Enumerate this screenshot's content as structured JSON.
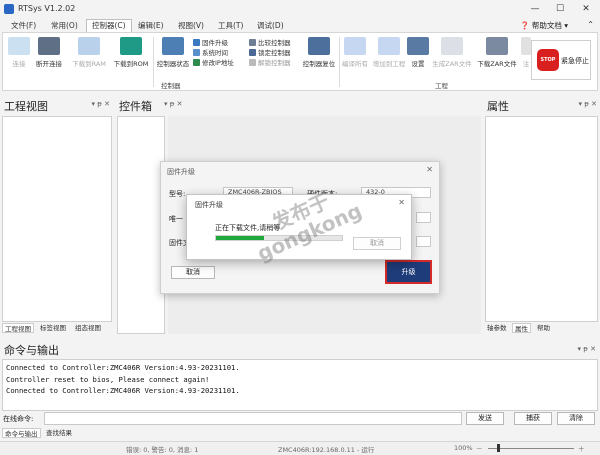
{
  "app": {
    "title": "RTSys V1.2.02"
  },
  "menu": {
    "items": [
      "文件(F)",
      "常用(O)",
      "控制器(C)",
      "编辑(E)",
      "视图(V)",
      "工具(T)",
      "调试(D)"
    ],
    "help": "帮助文档"
  },
  "ribbon": {
    "connect": "连接",
    "disconnect": "断开连接",
    "download_ram": "下载到RAM",
    "download_rom": "下载到ROM",
    "controller_status": "控制器状态",
    "firmware_upgrade": "固件升级",
    "system_time": "系统时间",
    "modify_ip": "修改IP地址",
    "compare_controller": "比较控制器",
    "lock_controller": "锁定控制器",
    "unlock_controller": "解锁控制器",
    "controller_reset": "控制器复位",
    "compile_all": "编译所有",
    "add_to_project": "增加到工程",
    "settings": "设置",
    "generate_zar": "生成ZAR文件",
    "download_zar": "下载ZAR文件",
    "more": "注",
    "group_controller": "控制器",
    "group_project": "工程",
    "estop": "紧急停止",
    "stop_text": "STOP"
  },
  "panels": {
    "project_view": "工程视图",
    "toolbox": "控件箱",
    "properties": "属性",
    "left_tabs": [
      "工程视图",
      "标签视图",
      "组态视图"
    ],
    "right_tabs": [
      "轴参数",
      "属性",
      "帮助"
    ]
  },
  "dlg_firmware": {
    "title": "固件升级",
    "model_label": "型号:",
    "model_value": "ZMC406R-ZBIOS",
    "hw_label": "硬件版本:",
    "hw_value": "432-0",
    "unique_label": "唯一",
    "firmware_label": "固件文",
    "cancel": "取消",
    "upgrade": "升级"
  },
  "dlg_progress": {
    "title": "固件升级",
    "message": "正在下载文件,请稍等",
    "cancel": "取消",
    "progress": 0.38
  },
  "watermark": {
    "line1": "发布于",
    "line2": "gongkong"
  },
  "output": {
    "title": "命令与输出",
    "lines": [
      "Connected to Controller:ZMC406R Version:4.93-20231101.",
      "Controller reset to bios, Please connect again!",
      "Connected to Controller:ZMC406R Version:4.93-20231101."
    ],
    "command_label": "在线命令:",
    "send": "发送",
    "capture": "捕获",
    "clear": "清除",
    "tabs": [
      "命令与输出",
      "查找结果"
    ]
  },
  "status": {
    "counts": "错误: 0, 警告: 0, 消息: 1",
    "connection": "ZMC406R:192.168.0.11 - 运行",
    "zoom": "100%"
  },
  "colors": {
    "accent": "#1f3c7a",
    "highlight": "#d42a2a",
    "progress": "#1fa83b"
  }
}
